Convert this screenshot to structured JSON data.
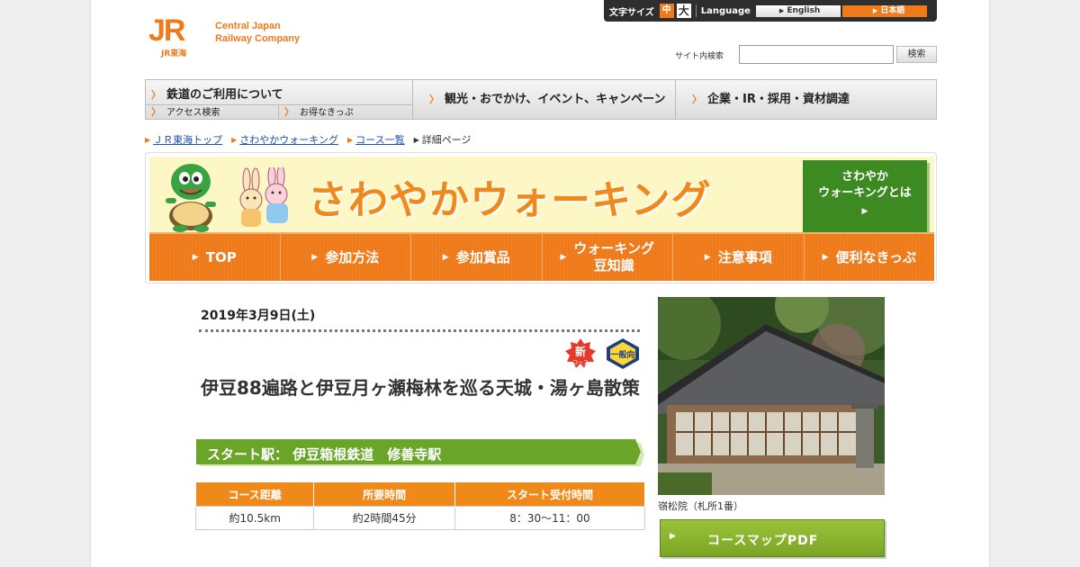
{
  "header": {
    "logo_mark": "JR",
    "logo_sub": "JR東海",
    "company_line1": "Central Japan",
    "company_line2": "Railway Company"
  },
  "util": {
    "font_size_label": "文字サイズ",
    "font_mid": "中",
    "font_large": "大",
    "language_label": "Language",
    "lang_english": "English",
    "lang_japanese": "日本語"
  },
  "search": {
    "label": "サイト内検索",
    "value": "",
    "button": "検索"
  },
  "gnav": {
    "rail": "鉄道のご利用について",
    "access": "アクセス検索",
    "tickets": "お得なきっぷ",
    "tourism": "観光・おでかけ、イベント、キャンペーン",
    "corporate": "企業・IR・採用・資材調達"
  },
  "breadcrumb": [
    "ＪＲ東海トップ",
    "さわやかウォーキング",
    "コース一覧",
    "詳細ページ"
  ],
  "banner": {
    "title": "さわやかウォーキング",
    "about_line1": "さわやか",
    "about_line2": "ウォーキングとは",
    "nav": [
      {
        "label": "TOP"
      },
      {
        "label": "参加方法"
      },
      {
        "label": "参加賞品"
      },
      {
        "label": "ウォーキング\n豆知識"
      },
      {
        "label": "注意事項"
      },
      {
        "label": "便利なきっぷ"
      }
    ]
  },
  "course": {
    "date": "2019年3月9日(土)",
    "badge_new": "新",
    "badge_new_sub": "コース",
    "badge_general": "一般向",
    "title": "伊豆88遍路と伊豆月ヶ瀬梅林を巡る天城・湯ヶ島散策",
    "start_station": "スタート駅： 伊豆箱根鉄道　修善寺駅",
    "table_headers": [
      "コース距離",
      "所要時間",
      "スタート受付時間"
    ],
    "table_values": [
      "約10.5km",
      "約2時間45分",
      "8：30～11：00"
    ]
  },
  "photo": {
    "caption": "嶺松院（札所1番）"
  },
  "pdf_button": "コースマップPDF",
  "colors": {
    "accent": "#ef7a1a",
    "green": "#3e8a22",
    "link": "#1a4fb4"
  }
}
